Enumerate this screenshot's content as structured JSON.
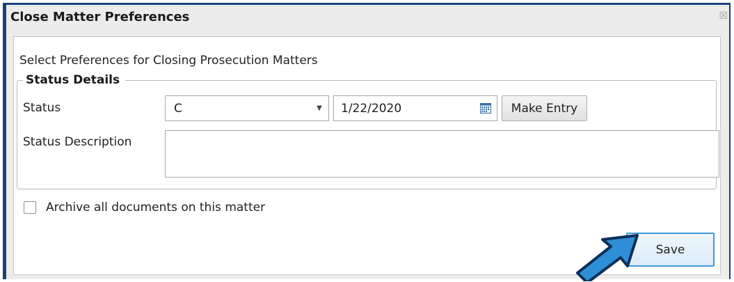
{
  "dialog": {
    "title": "Close Matter Preferences",
    "close_glyph": "☒"
  },
  "content": {
    "heading": "Select Preferences for Closing Prosecution Matters",
    "status_group": {
      "legend": "Status Details",
      "status_label": "Status",
      "status_value": "C",
      "dropdown_icon": "chevron-down-icon",
      "date_value": "1/22/2020",
      "calendar_icon": "calendar-icon",
      "make_entry_label": "Make Entry",
      "status_description_label": "Status Description",
      "status_description_value": ""
    },
    "archive_checkbox": {
      "label": "Archive all documents on this matter",
      "checked": false
    },
    "save_label": "Save"
  },
  "colors": {
    "window_border": "#1b3f7a",
    "focus_accent": "#3c9bd8",
    "pointer_arrow": "#2f8fd6"
  }
}
